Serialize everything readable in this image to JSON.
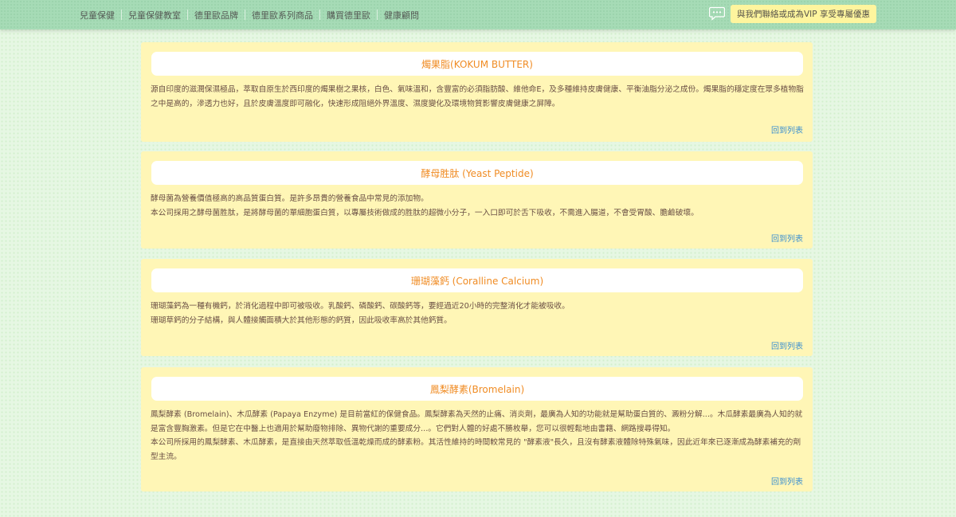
{
  "nav": {
    "links": [
      "兒童保健",
      "兒童保健教室",
      "德里歐品牌",
      "德里歐系列商品",
      "購買德里歐",
      "健康顧問"
    ],
    "chat_icon": "chat-bubble-icon",
    "vip_button": "與我們聯絡或成為VIP 享受專屬優惠"
  },
  "colors": {
    "nav_bg": "#a6dbb6",
    "card_bg": "#fff6b6",
    "title_color": "#f08c24",
    "body_text": "#6a4f44",
    "link_color": "#3a8fd0",
    "vip_bg": "#fef59e"
  },
  "cards": [
    {
      "title": "燭果脂(KOKUM BUTTER)",
      "paragraphs": [
        "源自印度的滋潤保濕極品，萃取自原生於西印度的燭果樹之果核，白色、氣味溫和，含豐富的必須脂肪酸、維他命E，及多種維持皮膚健康、平衡油脂分泌之成份。燭果脂的穩定度在眾多植物脂之中是高的，滲透力也好，且於皮膚溫度即可融化，快速形成阻絕外界溫度、濕度變化及環境物質影響皮膚健康之屏障。"
      ],
      "back_link": "回到列表"
    },
    {
      "title": "酵母胜肽 (Yeast Peptide)",
      "paragraphs": [
        "酵母菌為營養價值極高的高品質蛋白質。是許多昂貴的營養食品中常見的添加物。",
        "本公司採用之酵母菌胜肽，是將酵母菌的單細胞蛋白質，以專屬技術做成的胜肽的超微小分子，一入口即可於舌下吸收，不需進入腸道，不會受胃酸、膽鹼破壞。"
      ],
      "back_link": "回到列表"
    },
    {
      "title": "珊瑚藻鈣 (Coralline Calcium)",
      "paragraphs": [
        "珊瑚藻鈣為一種有機鈣，於消化過程中即可被吸收。乳酸鈣、磷酸鈣、碳酸鈣等，要經過近20小時的完整消化才能被吸收。",
        "珊瑚草鈣的分子結構，與人體接觸面積大於其他形態的鈣質，因此吸收率高於其他鈣質。"
      ],
      "back_link": "回到列表"
    },
    {
      "title": "鳳梨酵素(Bromelain)",
      "paragraphs": [
        "鳳梨酵素 (Bromelain)、木瓜酵素 (Papaya Enzyme) 是目前當紅的保健食品。鳳梨酵素為天然的止痛、消炎劑，最廣為人知的功能就是幫助蛋白質的、澱粉分解...。木瓜酵素最廣為人知的就是富含豐胸激素。但是它在中醫上也適用於幫助廢物排除、異物代謝的重要成分...。它們對人體的好處不勝枚舉，您可以很輕鬆地由書籍、網路搜尋得知。",
        "本公司所採用的鳳梨酵素、木瓜酵素，是直接由天然萃取低溫乾燥而成的酵素粉。其活性維持的時間較常見的 \"酵素液\"長久，且沒有酵素液體除特殊氣味，因此近年來已逐漸成為酵素補充的劑型主流。"
      ],
      "back_link": "回到列表"
    }
  ]
}
